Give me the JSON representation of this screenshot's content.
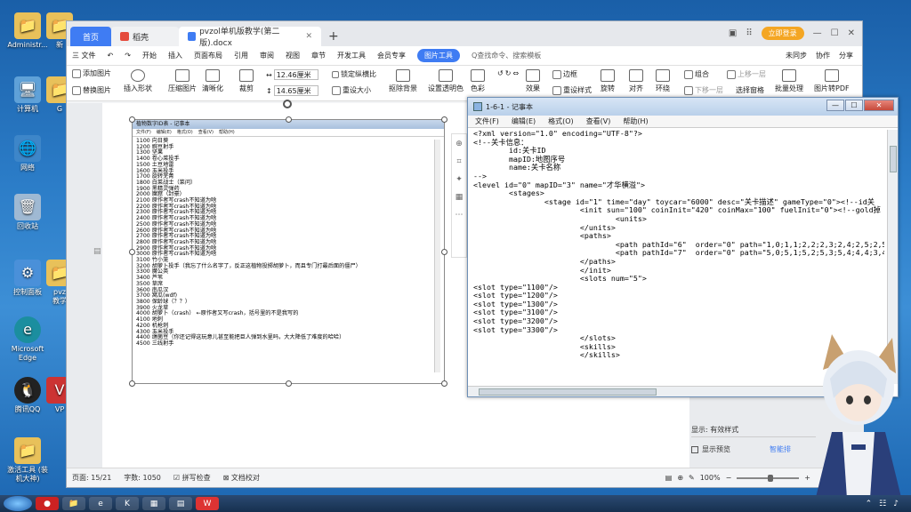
{
  "desktop": {
    "icons": [
      {
        "label": "Administr..."
      },
      {
        "label": "新"
      },
      {
        "label": "计算机"
      },
      {
        "label": "G"
      },
      {
        "label": "网络"
      },
      {
        "label": "回收站"
      },
      {
        "label": "控制面板"
      },
      {
        "label": "pvz\n教学"
      },
      {
        "label": "Microsoft\nEdge"
      },
      {
        "label": "腾讯QQ"
      },
      {
        "label": "VP"
      },
      {
        "label": "激活工具 (装\n机大神)"
      }
    ]
  },
  "wps": {
    "tabs": [
      {
        "label": "首页"
      },
      {
        "label": "稻壳"
      },
      {
        "label": "pvzol单机版教学(第二版).docx"
      }
    ],
    "new_tab": "+",
    "login": "立即登录",
    "menu": [
      "三 文件",
      "开始",
      "插入",
      "页面布局",
      "引用",
      "审阅",
      "视图",
      "章节",
      "开发工具",
      "会员专享",
      "图片工具"
    ],
    "search_placeholder": "Q查找命令、搜索模板",
    "menu_right": [
      "未同步",
      "协作",
      "分享"
    ],
    "ribbon": {
      "add_image": "添加图片",
      "replace_image": "替换图片",
      "insert_shape": "插入形状",
      "compress": "压缩图片",
      "clarity": "清晰化",
      "crop": "裁剪",
      "width": "12.46厘米",
      "height": "14.65厘米",
      "lock_ratio": "锁定纵横比",
      "reset_size": "重设大小",
      "remove_bg": "抠除背景",
      "set_transparent": "设置透明色",
      "color": "色彩",
      "effects": "效果",
      "reset_style": "重设样式",
      "border": "边框",
      "rotate": "旋转",
      "align": "对齐",
      "wrap": "环绕",
      "group": "组合",
      "up": "上移一层",
      "down": "下移一层",
      "select_pane": "选择窗格",
      "batch": "批量处理",
      "to_pdf": "图片转PDF"
    },
    "status": {
      "page": "页面: 15/21",
      "words": "字数: 1050",
      "spell": "拼写检查",
      "proof": "文档校对",
      "zoom": "100%"
    },
    "side_panel": {
      "show": "显示: 有效样式",
      "preview": "显示预览",
      "smart": "智能排"
    }
  },
  "embedded_image": {
    "title": "植物数字ID表 - 记事本",
    "menu": [
      "文件(F)",
      "编辑(E)",
      "格式(O)",
      "查看(V)",
      "帮助(H)"
    ],
    "lines": [
      "1100   向日葵",
      "1200   豌豆射手",
      "1300   坚果",
      "1400   卷心菜投手",
      "1500   土豆地雷",
      "1600   玉米投手",
      "1700   旋转芜菁",
      "1800   白菜战士（菜问）",
      "1900   黑精灵弹药",
      "2000   魔窟（封豪）",
      "2100   原作者写crash不知道为啥",
      "2200   原作者写crash不知道为啥",
      "2300   原作者写crash不知道为啥",
      "2400   原作者写crash不知道为啥",
      "2500   原作者写crash不知道为啥",
      "2600   原作者写crash不知道为啥",
      "2700   原作者写crash不知道为啥",
      "2800   原作者写crash不知道为啥",
      "2900   原作者写crash不知道为啥",
      "3000   原作者写crash不知道为啥",
      "3100   竹小笼",
      "3200   胡萝卜投手（我忘了什么名字了，反正这植物投掷胡萝卜，而且专门打最后面的僵尸）",
      "3300   魔公英",
      "3400   芦苇",
      "3500   草席",
      "3600   南瓜汉",
      "3700   窝瓜(wdf)",
      "3800   保龄球（？？）",
      "3900   火龙草",
      "4000   胡萝卜（crash）   ←原作者又写crash，括号里的不是我写的",
      "4100   地刺",
      "4200   机枪刺",
      "4300   玉米投手",
      "4400   缠菌豆（你还记得这玩意儿甚至能把巨人弹到水里吗，大大降低了难度的哈哈）",
      "4500   三线射手"
    ]
  },
  "notepad": {
    "title": "1-6-1 - 记事本",
    "menu": [
      "文件(F)",
      "编辑(E)",
      "格式(O)",
      "查看(V)",
      "帮助(H)"
    ],
    "content": "<?xml version=\"1.0\" encoding=\"UTF-8\"?>\n<!--关卡信息：\n        id:关卡ID\n        mapID:地图序号\n        name:关卡名称\n-->\n<level id=\"0\" mapID=\"3\" name=\"才华横溢\">\n        <stages>\n                <stage id=\"1\" time=\"day\" toycar=\"6000\" desc=\"关卡描述\" gameType=\"0\"><!--id关\n                        <init sun=\"100\" coinInit=\"420\" coinMax=\"100\" fuelInit=\"0\"><!--gold掉\n                                <units>\n                        </units>\n                        <paths>\n                                <path pathId=\"6\"  order=\"0\" path=\"1,0;1,1;2,2;2,3;2,4;2,5;2,5;3,5;\n                                <path pathId=\"7\"  order=\"0\" path=\"5,0;5,1;5,2;5,3;5,4;4,4;3,4;2,4;1,\n                        </paths>\n                        </init>\n                        <slots num=\"5\">\n<slot type=\"1100\"/>\n<slot type=\"1200\"/>\n<slot type=\"1300\"/>\n<slot type=\"3100\"/>\n<slot type=\"3200\"/>\n<slot type=\"3300\"/>\n                        </slots>\n                        <skills>\n                        </skills>"
  },
  "colors": {
    "accent": "#3f7cf3",
    "login": "#f4a623",
    "desktop": "#2b7cc7"
  }
}
